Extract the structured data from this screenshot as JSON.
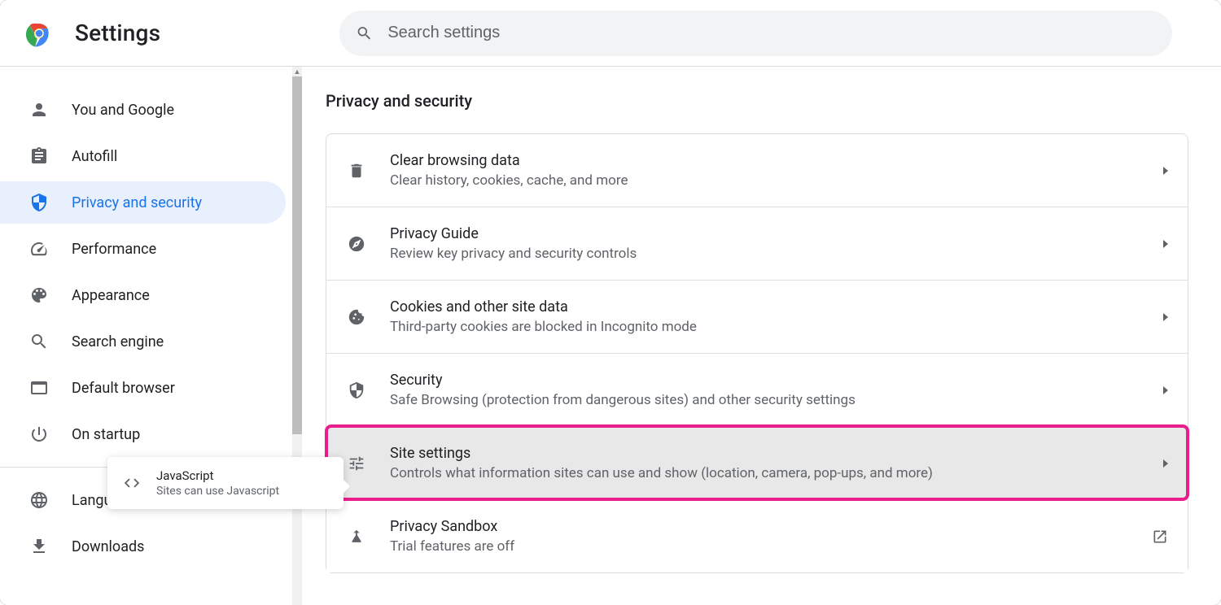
{
  "header": {
    "title": "Settings",
    "search_placeholder": "Search settings"
  },
  "sidebar": {
    "items": [
      {
        "id": "you-and-google",
        "label": "You and Google",
        "icon": "person-icon",
        "active": false
      },
      {
        "id": "autofill",
        "label": "Autofill",
        "icon": "clipboard-icon",
        "active": false
      },
      {
        "id": "privacy-and-security",
        "label": "Privacy and security",
        "icon": "shield-icon",
        "active": true
      },
      {
        "id": "performance",
        "label": "Performance",
        "icon": "speedometer-icon",
        "active": false
      },
      {
        "id": "appearance",
        "label": "Appearance",
        "icon": "palette-icon",
        "active": false
      },
      {
        "id": "search-engine",
        "label": "Search engine",
        "icon": "search-icon",
        "active": false
      },
      {
        "id": "default-browser",
        "label": "Default browser",
        "icon": "browser-icon",
        "active": false
      },
      {
        "id": "on-startup",
        "label": "On startup",
        "icon": "power-icon",
        "active": false
      }
    ],
    "secondary": [
      {
        "id": "languages",
        "label": "Languages",
        "icon": "globe-icon"
      },
      {
        "id": "downloads",
        "label": "Downloads",
        "icon": "download-icon"
      }
    ]
  },
  "main": {
    "section_title": "Privacy and security",
    "rows": [
      {
        "id": "clear-browsing-data",
        "icon": "delete-icon",
        "title": "Clear browsing data",
        "sub": "Clear history, cookies, cache, and more",
        "action": "arrow"
      },
      {
        "id": "privacy-guide",
        "icon": "compass-icon",
        "title": "Privacy Guide",
        "sub": "Review key privacy and security controls",
        "action": "arrow"
      },
      {
        "id": "cookies",
        "icon": "cookie-icon",
        "title": "Cookies and other site data",
        "sub": "Third-party cookies are blocked in Incognito mode",
        "action": "arrow"
      },
      {
        "id": "security",
        "icon": "security-icon",
        "title": "Security",
        "sub": "Safe Browsing (protection from dangerous sites) and other security settings",
        "action": "arrow"
      },
      {
        "id": "site-settings",
        "icon": "tune-icon",
        "title": "Site settings",
        "sub": "Controls what information sites can use and show (location, camera, pop-ups, and more)",
        "action": "arrow",
        "highlighted": true
      },
      {
        "id": "privacy-sandbox",
        "icon": "flask-icon",
        "title": "Privacy Sandbox",
        "sub": "Trial features are off",
        "action": "external"
      }
    ]
  },
  "tooltip": {
    "title": "JavaScript",
    "sub": "Sites can use Javascript"
  }
}
